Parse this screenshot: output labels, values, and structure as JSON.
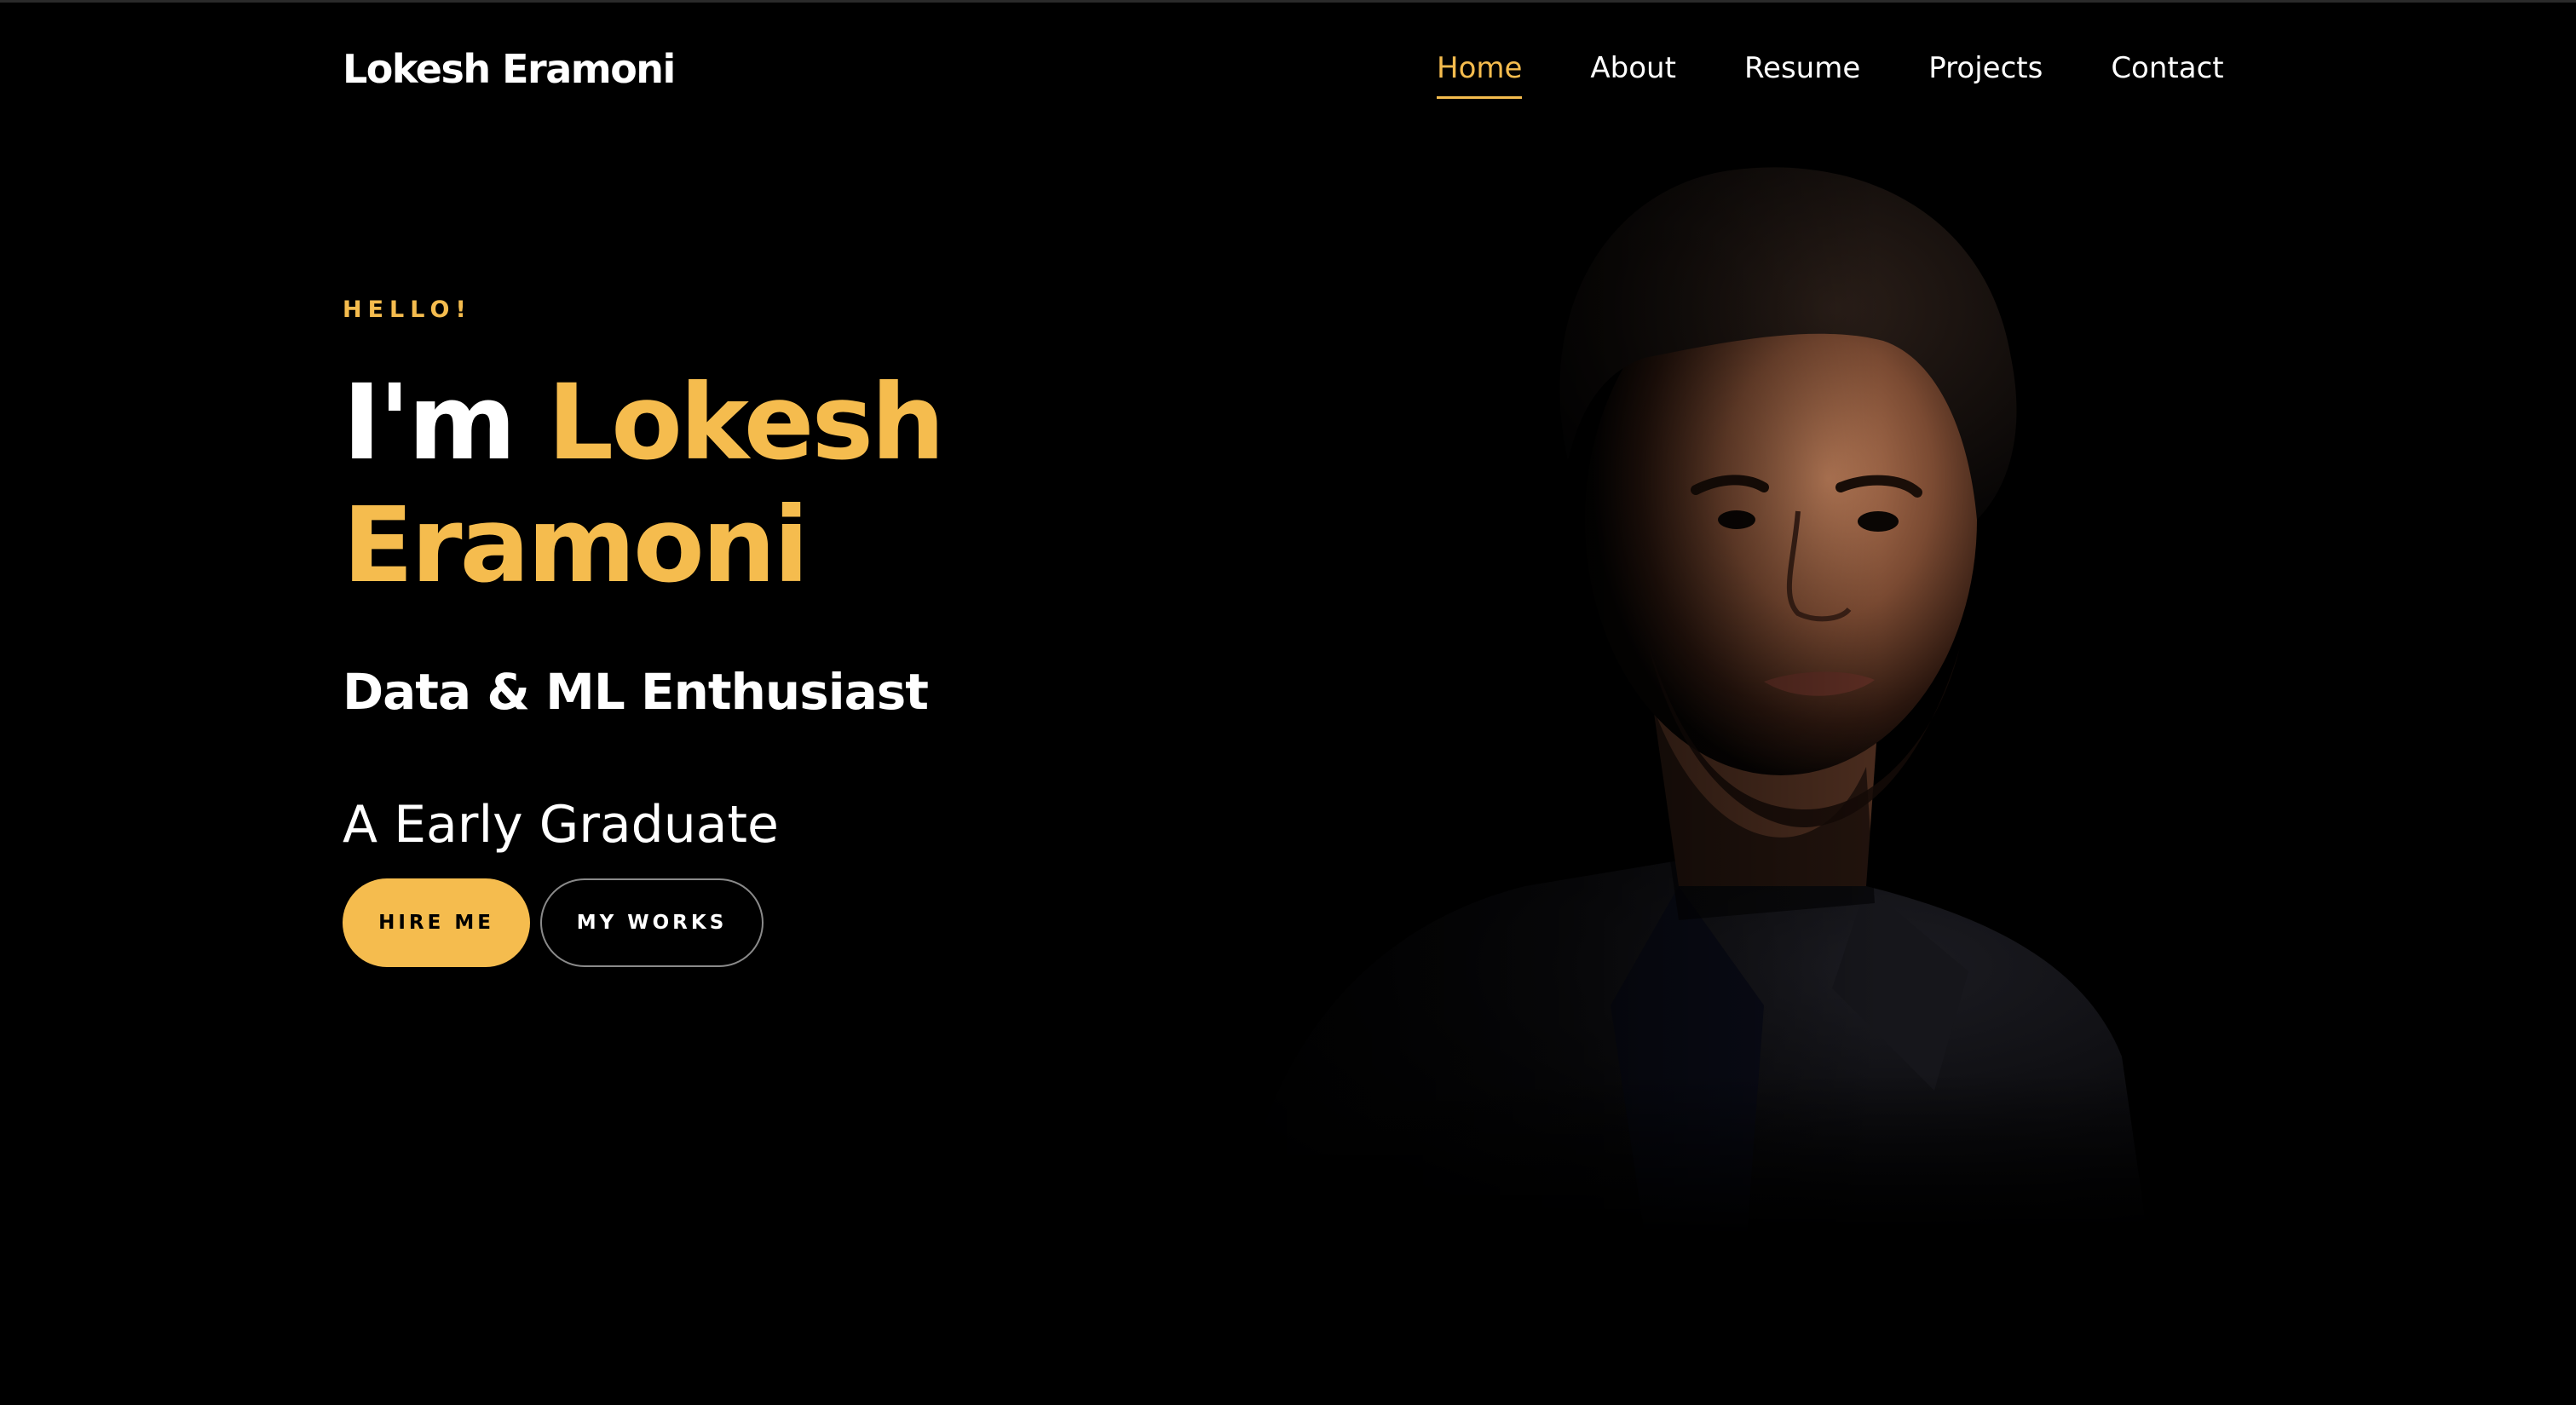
{
  "header": {
    "brand": "Lokesh Eramoni",
    "nav": [
      {
        "label": "Home",
        "active": true
      },
      {
        "label": "About",
        "active": false
      },
      {
        "label": "Resume",
        "active": false
      },
      {
        "label": "Projects",
        "active": false
      },
      {
        "label": "Contact",
        "active": false
      }
    ]
  },
  "hero": {
    "greeting": "HELLO!",
    "headline_prefix": "I'm ",
    "headline_first_name": "Lokesh",
    "headline_last_name": "Eramoni",
    "role": "Data & ML Enthusiast",
    "subtitle": "A Early Graduate",
    "primary_button": "HIRE ME",
    "secondary_button": "MY WORKS"
  },
  "colors": {
    "accent": "#f5bc4e",
    "background": "#000000",
    "text": "#ffffff"
  }
}
